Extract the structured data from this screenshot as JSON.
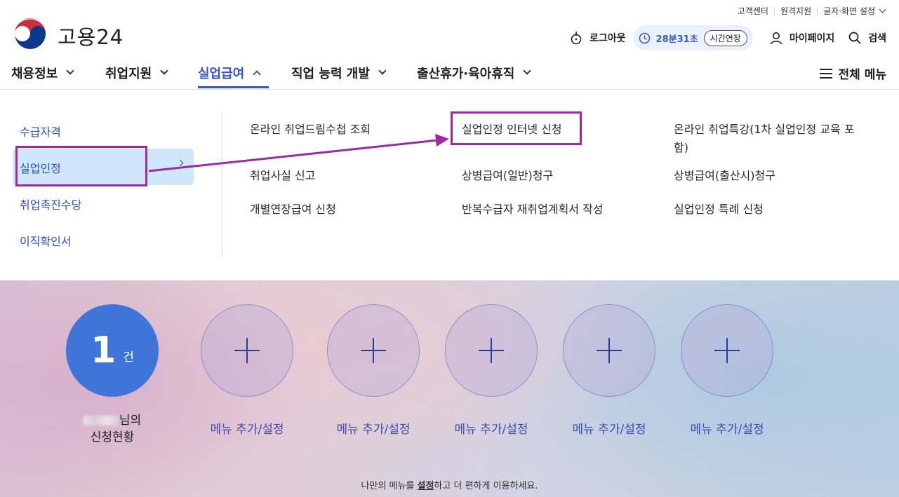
{
  "utility": [
    "고객센터",
    "원격지원",
    "글자·화면 설정"
  ],
  "logo": {
    "name": "고용24"
  },
  "tools": {
    "logout": "로그아웃",
    "session_time": "28분31초",
    "extend": "시간연장",
    "mypage": "마이페이지",
    "search": "검색"
  },
  "gnb": {
    "items": [
      "채용정보",
      "취업지원",
      "실업급여",
      "직업 능력 개발",
      "출산휴가·육아휴직"
    ],
    "active": "실업급여",
    "all_menu": "전체 메뉴"
  },
  "submenu": {
    "side": [
      "수급자격",
      "실업인정",
      "취업촉진수당",
      "이직확인서"
    ],
    "links": [
      "온라인 취업드림수첩 조회",
      "실업인정 인터넷 신청",
      "온라인 취업특강(1차 실업인정 교육 포",
      "함)",
      "취업사실 신고",
      "상병급여(일반)청구",
      "상병급여(출산시)청구",
      "개별연장급여 신청",
      "반복수급자 재취업계획서 작성",
      "실업인정 특례 신청"
    ]
  },
  "dashboard": {
    "count": "1",
    "unit": "건",
    "owner_suffix": "님의",
    "owner_line2": "신청현황",
    "add_label": "메뉴 추가/설정",
    "tip_pre": "나만의 메뉴를 ",
    "tip_bold": "설정",
    "tip_post": "하고 더 편하게 이용하세요."
  },
  "colors": {
    "accent": "#3258c7",
    "annotation": "#9b2aa3",
    "count_circle": "#3f74d9"
  }
}
